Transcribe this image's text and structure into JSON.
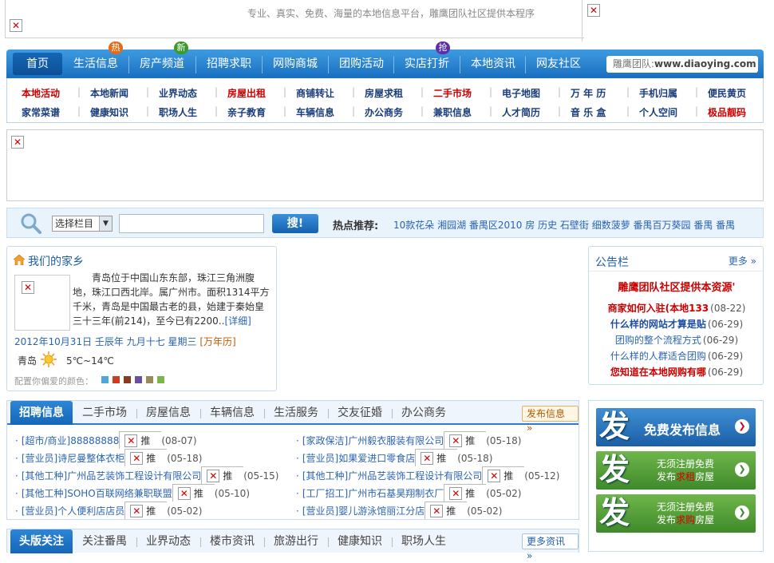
{
  "top": {
    "slogan": "专业、真实、免费、海量的本地信息平台，雕鹰团队社区提供本程序"
  },
  "nav": {
    "items": [
      {
        "label": "首页"
      },
      {
        "label": "生活信息",
        "badge": "热"
      },
      {
        "label": "房产频道",
        "badge": "新"
      },
      {
        "label": "招聘求职"
      },
      {
        "label": "网购商城"
      },
      {
        "label": "团购活动"
      },
      {
        "label": "实店打折",
        "badge": "抢"
      },
      {
        "label": "本地资讯"
      },
      {
        "label": "网友社区"
      }
    ],
    "site_prefix": "雕鹰团队:",
    "site_url": "www.diaoying.com",
    "colors": {
      "hot": "#e06c1a",
      "new": "#3a9a2a",
      "grab": "#5b2fa8"
    }
  },
  "subnav": {
    "row1": [
      "本地活动",
      "本地新闻",
      "业界动态",
      "房屋出租",
      "商铺转让",
      "房屋求租",
      "二手市场",
      "电子地图",
      "万 年 历",
      "手机归属",
      "便民黄页"
    ],
    "row2": [
      "家常菜谱",
      "健康知识",
      "职场人生",
      "亲子教育",
      "车辆信息",
      "办公商务",
      "兼职信息",
      "人才简历",
      "音 乐 盒",
      "个人空间",
      "极品靓码"
    ]
  },
  "search": {
    "select_value": "选择栏目",
    "input_value": "",
    "button_label": "搜!",
    "hot_label": "热点推荐:",
    "hot_items": "10款花朵 湘园湖 番禺区2010 房 历史 石壁街 细数菠萝 番禺百万葵园 番禺 番禺"
  },
  "hometown": {
    "title": "我们的家乡",
    "text": "青岛位于中国山东东部，珠江三角洲腹地，珠江口西北岸。属广州市。面积1314平方千米，青岛是中国最古老的县，始建于秦始皇三十三年(前214)，至今已有2200..",
    "detail_link": "[详细]",
    "date": "2012年10月31日  壬辰年  九月十七  星期三",
    "calendar_link": "[万年历]",
    "city": "青岛",
    "temp": "5℃~14℃",
    "colors_label": "配置你偏爱的颜色：",
    "swatches": [
      "#4ea6e0",
      "#d13a22",
      "#8a3a1e",
      "#6a4fa6",
      "#9a8a5a",
      "#7ab648"
    ]
  },
  "notice": {
    "title": "公告栏",
    "more": "更多 »",
    "headline": "雕鹰团队社区提供本资源'",
    "items": [
      {
        "text": "商家如何入驻(本地133",
        "date": "(08-22)",
        "style": "red-bold"
      },
      {
        "text": "什么样的网站才算是贴",
        "date": "(06-29)",
        "style": "blue-bold"
      },
      {
        "text": "团购的整个流程方式",
        "date": "(06-29)",
        "style": "normal"
      },
      {
        "text": "什么样的人群适合团购",
        "date": "(06-29)",
        "style": "normal"
      },
      {
        "text": "您知道在本地网购有哪",
        "date": "(06-29)",
        "style": "red-bold"
      }
    ]
  },
  "recruit": {
    "tabs": [
      "招聘信息",
      "二手市场",
      "房屋信息",
      "车辆信息",
      "生活服务",
      "交友征婚",
      "办公商务"
    ],
    "post_button": "发布信息 »",
    "left": [
      {
        "cat": "[超市/商业]",
        "name": "88888888",
        "rec": "推",
        "date": "(08-07)"
      },
      {
        "cat": "[营业员]",
        "name": "诗尼曼整体衣柜",
        "rec": "推",
        "date": "(05-18)"
      },
      {
        "cat": "[其他工种]",
        "name": "广州品艺装饰工程设计有限公司",
        "rec": "推",
        "date": "(05-15)"
      },
      {
        "cat": "[其他工种]",
        "name": "SOHO百联网络兼职联盟",
        "rec": "推",
        "date": "(05-10)"
      },
      {
        "cat": "[营业员]",
        "name": "个人便利店店员",
        "rec": "推",
        "date": "(05-02)"
      }
    ],
    "right": [
      {
        "cat": "[家政保洁]",
        "name": "广州毅衣服装有限公司",
        "rec": "推",
        "date": "(05-18)"
      },
      {
        "cat": "[营业员]",
        "name": "如果爱进口零食店",
        "rec": "推",
        "date": "(05-18)"
      },
      {
        "cat": "[其他工种]",
        "name": "广州品艺装饰工程设计有限公司",
        "rec": "推",
        "date": "(05-12)"
      },
      {
        "cat": "[工厂招工]",
        "name": "广州市石基昊翔制衣厂",
        "rec": "推",
        "date": "(05-02)"
      },
      {
        "cat": "[营业员]",
        "name": "婴儿游泳馆丽江分店",
        "rec": "推",
        "date": "(05-02)"
      }
    ]
  },
  "headlines": {
    "tabs": [
      "头版关注",
      "关注番禺",
      "业界动态",
      "楼市资讯",
      "旅游出行",
      "健康知识",
      "职场人生"
    ],
    "more": "更多资讯 »"
  },
  "post_blocks": {
    "fa_char": "发",
    "b1": "免费发布信息",
    "b2_line1": "无须注册免费",
    "b2_line2a": "发布",
    "b2_line2b": "求租",
    "b2_line2c": "房屋",
    "b3_line1": "无须注册免费",
    "b3_line2a": "发布",
    "b3_line2b": "求购",
    "b3_line2c": "房屋"
  }
}
